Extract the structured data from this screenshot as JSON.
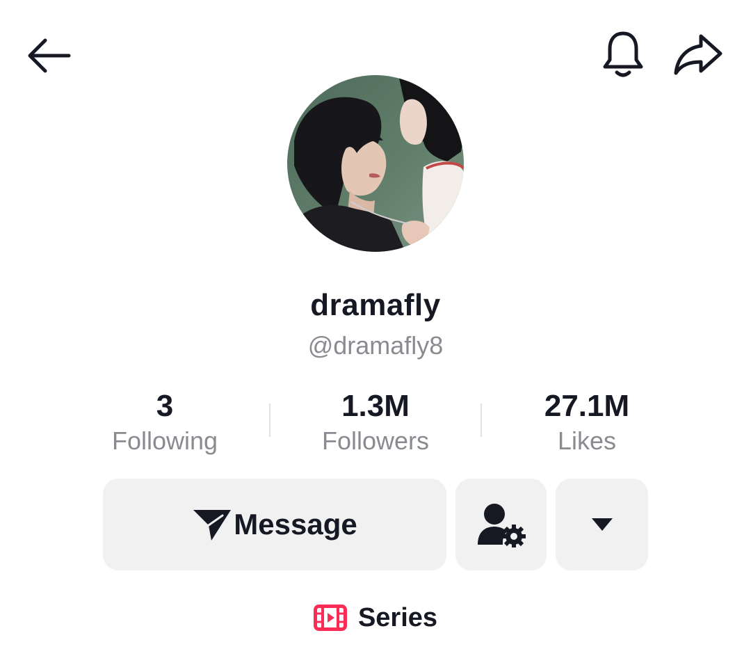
{
  "nav": {
    "back_icon": "arrow-left-icon",
    "bell_icon": "bell-icon",
    "share_icon": "share-arrow-icon"
  },
  "profile": {
    "avatar_icon": "profile-photo",
    "display_name": "dramafly",
    "username": "@dramafly8"
  },
  "stats": [
    {
      "value": "3",
      "label": "Following"
    },
    {
      "value": "1.3M",
      "label": "Followers"
    },
    {
      "value": "27.1M",
      "label": "Likes"
    }
  ],
  "actions": {
    "message_label": "Message",
    "message_icon": "paper-plane-icon",
    "friend_settings_icon": "user-gear-icon",
    "more_icon": "caret-down-icon"
  },
  "tabs": {
    "series_label": "Series",
    "series_icon": "film-strip-icon"
  },
  "colors": {
    "text_primary": "#161823",
    "text_secondary": "#8a8b91",
    "button_bg": "#f1f1f2",
    "series_accent": "#fe2c55"
  }
}
